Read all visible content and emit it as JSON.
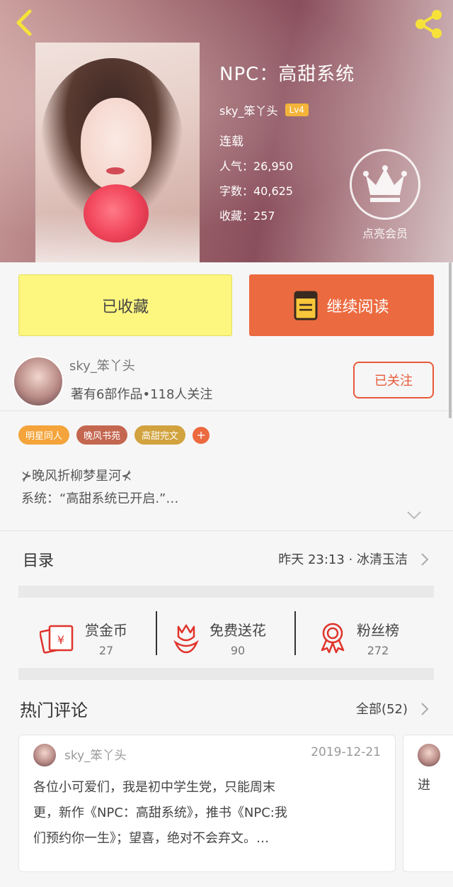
{
  "header": {
    "title": "NPC：高甜系统",
    "author": "sky_笨丫头",
    "level": "Lv4",
    "status": "连载",
    "popularity": "人气：26,950",
    "word_count": "字数：40,625",
    "favorites": "收藏：257",
    "vip_label": "点亮会员"
  },
  "actions": {
    "favorited_label": "已收藏",
    "continue_label": "继续阅读"
  },
  "author_card": {
    "name": "sky_笨丫头",
    "meta": "著有6部作品•118人关注",
    "follow_label": "已关注"
  },
  "tags": [
    "明星同人",
    "晚风书苑",
    "高甜完文"
  ],
  "tag_more": "+",
  "intro": {
    "line1": "⊁晚风折柳梦星河⊀",
    "line2": "系统：“高甜系统已开启.”…"
  },
  "catalog": {
    "title": "目录",
    "latest": "昨天 23:13 · 冰清玉洁"
  },
  "stats": [
    {
      "label": "赏金币",
      "value": "27",
      "icon": "reward-coin-icon"
    },
    {
      "label": "免费送花",
      "value": "90",
      "icon": "flower-icon"
    },
    {
      "label": "粉丝榜",
      "value": "272",
      "icon": "ranking-medal-icon"
    }
  ],
  "comments": {
    "title": "热门评论",
    "all_label": "全部(52)",
    "items": [
      {
        "user": "sky_笨丫头",
        "date": "2019-12-21",
        "line1": "各位小可爱们，我是初中学生党，只能周末",
        "line2": "更，新作《NPC：高甜系统》，推书《NPC:我",
        "line3": "们预约你一生》；望喜，绝对不会弃文。…"
      },
      {
        "text": "进"
      }
    ]
  },
  "colors": {
    "accent": "#ec6a3f",
    "favorite_yellow": "#fdf67f",
    "follow_red": "#e85a3a"
  }
}
